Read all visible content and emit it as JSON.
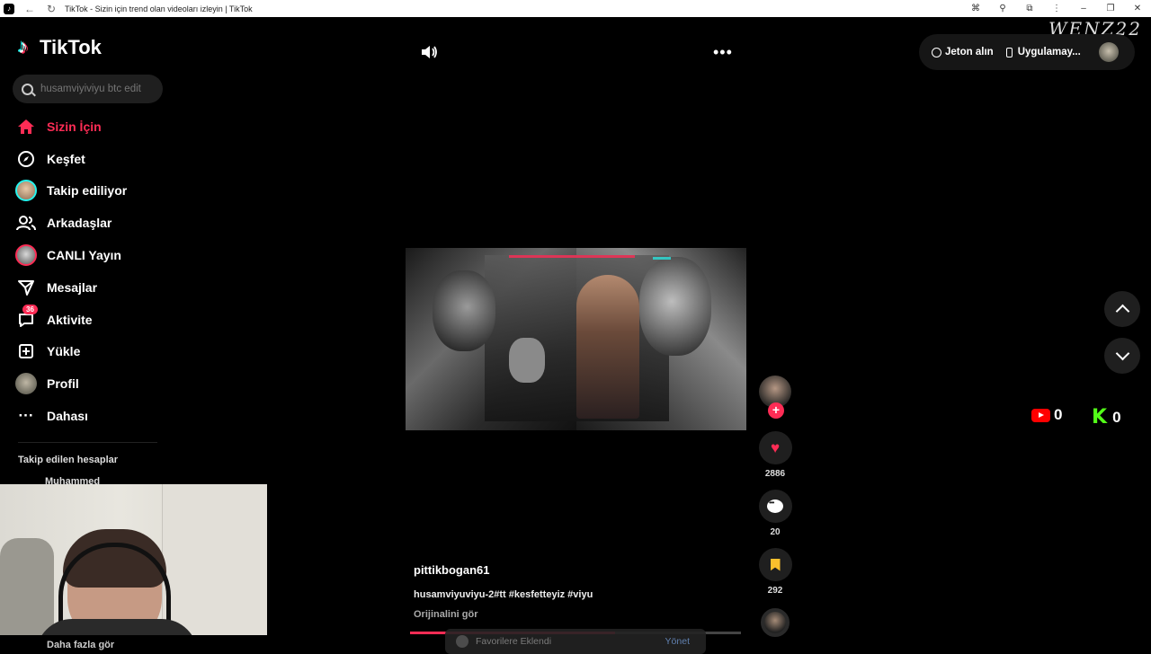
{
  "browser": {
    "title": "TikTok - Sizin için trend olan videoları izleyin | TikTok"
  },
  "watermark": "WENZ22",
  "app": {
    "name": "TikTok"
  },
  "search": {
    "placeholder": "husamviyiviyu btc edit"
  },
  "sidebar": {
    "items": [
      {
        "label": "Sizin İçin",
        "icon": "home-icon",
        "active": true
      },
      {
        "label": "Keşfet",
        "icon": "compass-icon"
      },
      {
        "label": "Takip ediliyor",
        "icon": "following-avatar-icon"
      },
      {
        "label": "Arkadaşlar",
        "icon": "friends-icon"
      },
      {
        "label": "CANLI Yayın",
        "icon": "live-avatar-icon"
      },
      {
        "label": "Mesajlar",
        "icon": "send-icon"
      },
      {
        "label": "Aktivite",
        "icon": "activity-icon",
        "badge": "36"
      },
      {
        "label": "Yükle",
        "icon": "upload-icon"
      },
      {
        "label": "Profil",
        "icon": "profile-avatar-icon"
      },
      {
        "label": "Dahası",
        "icon": "more-icon"
      }
    ],
    "following_title": "Takip edilen hesaplar",
    "following_first": "Muhammed",
    "following_cutoff": "Daha fazla gör"
  },
  "header": {
    "coins_label": "Jeton alın",
    "app_label": "Uygulamay..."
  },
  "video": {
    "author": "pittikbogan61",
    "caption": "husamviyuviyu-2#tt #kesfetteyiz #viyu",
    "original_link": "Orijinalini gör",
    "progress": 0.62,
    "likes": "2886",
    "comments": "20",
    "saves": "292",
    "follow_plus": "+"
  },
  "toast": {
    "text": "Favorilere Eklendi",
    "action": "Yönet"
  },
  "overlay": {
    "youtube_count": "0",
    "kick_count": "0",
    "kick_letter": "K"
  },
  "colors": {
    "accent": "#fe2c55",
    "cyan": "#25f4ee",
    "bookmark": "#fbc02d",
    "kick": "#53fc18",
    "youtube": "#ff0000"
  }
}
